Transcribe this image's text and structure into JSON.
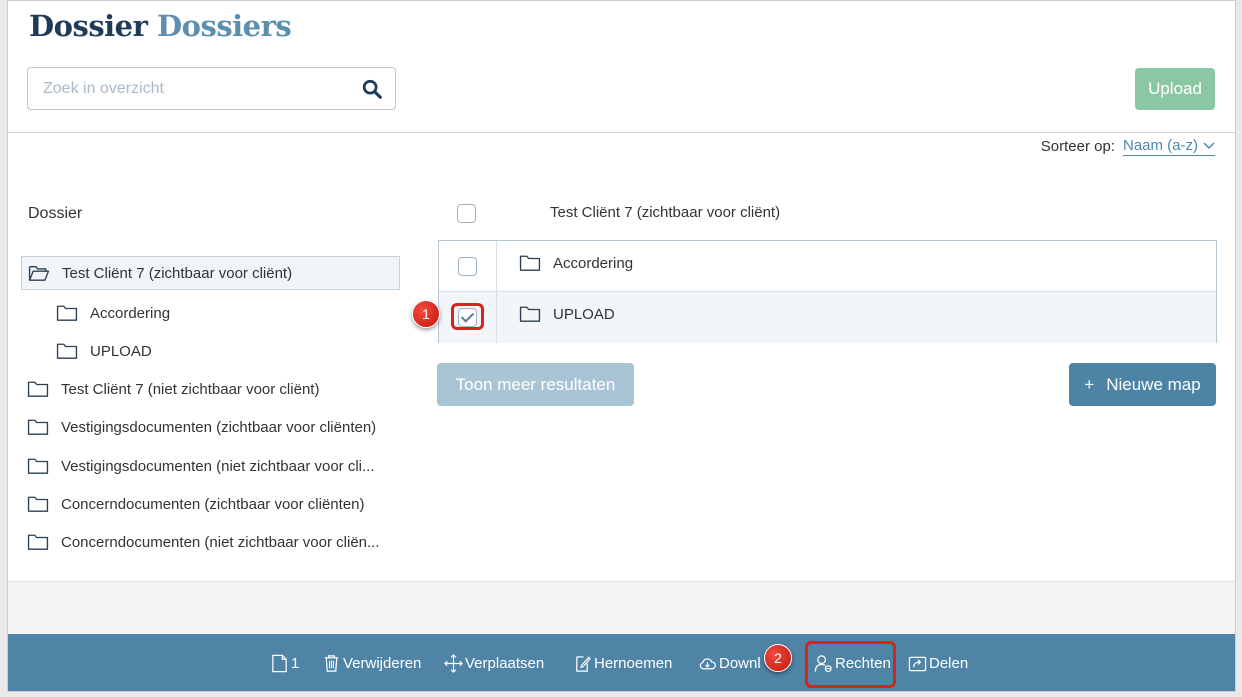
{
  "header": {
    "title_part1": "Dossier",
    "title_part2": "Dossiers"
  },
  "search": {
    "placeholder": "Zoek in overzicht",
    "value": ""
  },
  "upload_label": "Upload",
  "sort": {
    "label": "Sorteer op:",
    "value": "Naam (a-z)"
  },
  "sidebar": {
    "heading": "Dossier",
    "items": [
      {
        "label": "Test Cliënt 7 (zichtbaar voor cliënt)",
        "icon": "folder-open-icon",
        "selected": true
      },
      {
        "label": "Accordering",
        "icon": "folder-icon"
      },
      {
        "label": "UPLOAD",
        "icon": "folder-icon"
      },
      {
        "label": "Test Cliënt 7 (niet zichtbaar voor cliënt)",
        "icon": "folder-icon"
      },
      {
        "label": "Vestigingsdocumenten (zichtbaar voor cliënten)",
        "icon": "folder-icon"
      },
      {
        "label": "Vestigingsdocumenten (niet zichtbaar voor cli...",
        "icon": "folder-icon"
      },
      {
        "label": "Concerndocumenten (zichtbaar voor cliënten)",
        "icon": "folder-icon"
      },
      {
        "label": "Concerndocumenten (niet zichtbaar voor cliën...",
        "icon": "folder-icon"
      }
    ]
  },
  "list": {
    "header_title": "Test Cliënt 7 (zichtbaar voor cliënt)",
    "rows": [
      {
        "name": "Accordering",
        "checked": false
      },
      {
        "name": "UPLOAD",
        "checked": true
      }
    ]
  },
  "buttons": {
    "more_results": "Toon meer resultaten",
    "new_folder": "Nieuwe map",
    "new_folder_prefix": "+"
  },
  "toolbar": {
    "selected_count": "1",
    "delete": "Verwijderen",
    "move": "Verplaatsen",
    "rename": "Hernoemen",
    "download": "Downl",
    "rights": "Rechten",
    "share": "Delen"
  },
  "annotations": {
    "badge1": "1",
    "badge2": "2",
    "color": "#d9211d"
  },
  "colors": {
    "brand_dark": "#1f3b57",
    "brand_light": "#5b8fb0",
    "toolbar_bg": "#4f84a6",
    "upload_green": "#8ac8a3",
    "accent_blue": "#4d84a5"
  }
}
